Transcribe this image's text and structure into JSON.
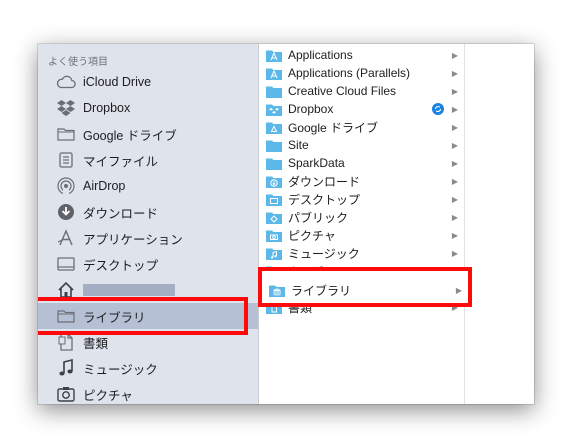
{
  "sidebar": {
    "heading": "よく使う項目",
    "items": [
      {
        "label": "iCloud Drive",
        "icon": "cloud-icon"
      },
      {
        "label": "Dropbox",
        "icon": "dropbox-icon"
      },
      {
        "label": "Google ドライブ",
        "icon": "folder-icon"
      },
      {
        "label": "マイファイル",
        "icon": "all-files-icon"
      },
      {
        "label": "AirDrop",
        "icon": "airdrop-icon"
      },
      {
        "label": "ダウンロード",
        "icon": "download-icon"
      },
      {
        "label": "アプリケーション",
        "icon": "applications-icon"
      },
      {
        "label": "デスクトップ",
        "icon": "desktop-icon"
      },
      {
        "label": "",
        "icon": "home-icon",
        "redacted": true
      },
      {
        "label": "ライブラリ",
        "icon": "folder-icon"
      },
      {
        "label": "書類",
        "icon": "document-icon"
      },
      {
        "label": "ミュージック",
        "icon": "music-note-icon"
      },
      {
        "label": "ピクチャ",
        "icon": "camera-icon"
      }
    ]
  },
  "column2": {
    "items": [
      {
        "label": "Applications",
        "icon": "applications-folder-icon"
      },
      {
        "label": "Applications (Parallels)",
        "icon": "applications-folder-icon"
      },
      {
        "label": "Creative Cloud Files",
        "icon": "folder-icon"
      },
      {
        "label": "Dropbox",
        "icon": "dropbox-folder-icon",
        "synced": true
      },
      {
        "label": "Google ドライブ",
        "icon": "google-drive-folder-icon"
      },
      {
        "label": "Site",
        "icon": "folder-icon"
      },
      {
        "label": "SparkData",
        "icon": "folder-icon"
      },
      {
        "label": "ダウンロード",
        "icon": "downloads-folder-icon"
      },
      {
        "label": "デスクトップ",
        "icon": "desktop-folder-icon"
      },
      {
        "label": "パブリック",
        "icon": "public-folder-icon"
      },
      {
        "label": "ピクチャ",
        "icon": "pictures-folder-icon"
      },
      {
        "label": "ミュージック",
        "icon": "music-folder-icon"
      },
      {
        "label": "ムービー",
        "icon": "movies-folder-icon"
      },
      {
        "label": "ライブラリ",
        "icon": "library-folder-icon"
      },
      {
        "label": "書類",
        "icon": "documents-folder-icon"
      }
    ]
  },
  "colors": {
    "sidebar_bg": "#dfe3ec",
    "selected_bg": "#b6c0d4",
    "folder_blue": "#5db8ea",
    "highlight_red": "#ff0a0a"
  }
}
